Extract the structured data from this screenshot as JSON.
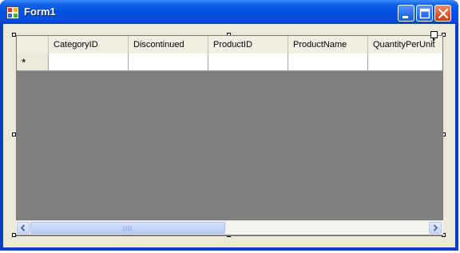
{
  "window": {
    "title": "Form1",
    "controls": [
      "minimize-icon",
      "maximize-icon",
      "close-icon"
    ]
  },
  "grid": {
    "columns": [
      "CategoryID",
      "Discontinued",
      "ProductID",
      "ProductName",
      "QuantityPerUnit"
    ],
    "new_row_marker": "*",
    "rows": [
      [
        "",
        "",
        "",
        "",
        ""
      ]
    ]
  },
  "scrollbar": {
    "grip": "||||"
  },
  "colors": {
    "titlebar": "#0054e3",
    "client": "#ece9d8",
    "grid_background": "#808080",
    "close_button": "#e2532a"
  }
}
